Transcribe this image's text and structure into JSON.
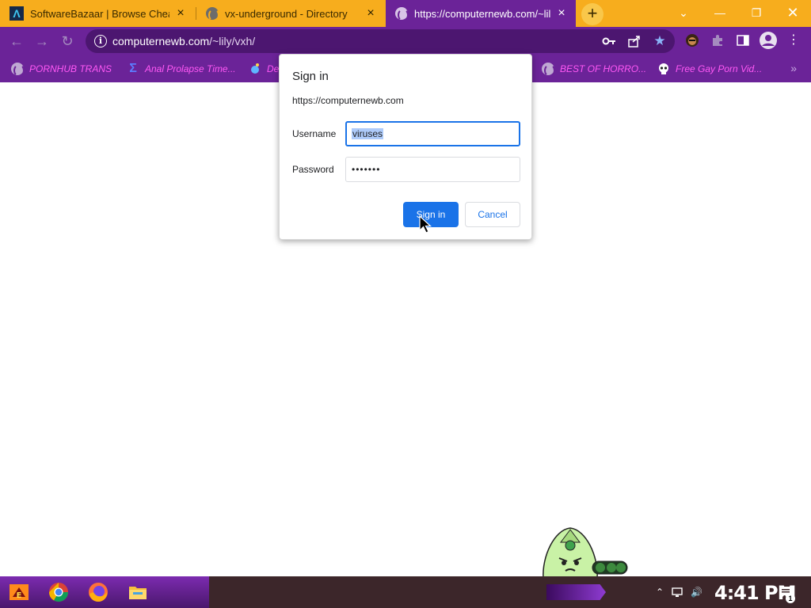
{
  "browser": {
    "tabs": [
      {
        "title": "SoftwareBazaar | Browse Chea",
        "icon": "softwarebazaar-logo-icon",
        "active": false
      },
      {
        "title": "vx-underground - Directory",
        "icon": "globe-icon",
        "active": false
      },
      {
        "title": "https://computernewb.com/~lil",
        "icon": "globe-icon",
        "active": true
      }
    ],
    "new_tab_label": "+",
    "url_host": "computernewb.com",
    "url_path": "/~lily/vxh/",
    "bookmarks": [
      {
        "label": "PORNHUB TRANS",
        "icon": "globe-icon"
      },
      {
        "label": "Anal Prolapse Time...",
        "icon": "sigma-icon"
      },
      {
        "label": "De",
        "icon": "bubble-icon"
      },
      {
        "label": "BEST OF HORRO...",
        "icon": "globe-icon"
      },
      {
        "label": "Free Gay Porn Vid...",
        "icon": "skull-icon"
      }
    ],
    "bookmarks_overflow": "»",
    "accent_color": "#6b2398",
    "tab_strip_color": "#f7ad1d"
  },
  "dialog": {
    "title": "Sign in",
    "origin": "https://computernewb.com",
    "username_label": "Username",
    "username_value": "viruses",
    "password_label": "Password",
    "password_value": "•••••••",
    "sign_in_label": "Sign in",
    "cancel_label": "Cancel"
  },
  "taskbar": {
    "clock": "4:41 PM",
    "notification_count": "1"
  }
}
